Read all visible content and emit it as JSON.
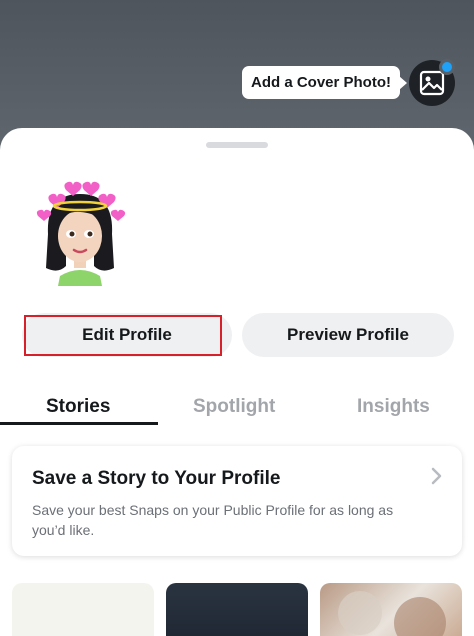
{
  "cover": {
    "tooltip": "Add a Cover Photo!",
    "button_icon": "image-add-icon",
    "badge_color": "#1ea1f7"
  },
  "profile": {
    "avatar_icon": "bitmoji-avatar"
  },
  "actions": {
    "edit_profile": "Edit Profile",
    "preview_profile": "Preview Profile"
  },
  "tabs": [
    {
      "label": "Stories",
      "active": true
    },
    {
      "label": "Spotlight",
      "active": false
    },
    {
      "label": "Insights",
      "active": false
    }
  ],
  "story_card": {
    "title": "Save a Story to Your Profile",
    "description": "Save your best Snaps on your Public Profile for as long as you’d like.",
    "chevron_icon": "chevron-right-icon"
  },
  "colors": {
    "highlight_outline": "#d8202a",
    "text_primary": "#16191c",
    "text_inactive": "#a2a6ab"
  }
}
